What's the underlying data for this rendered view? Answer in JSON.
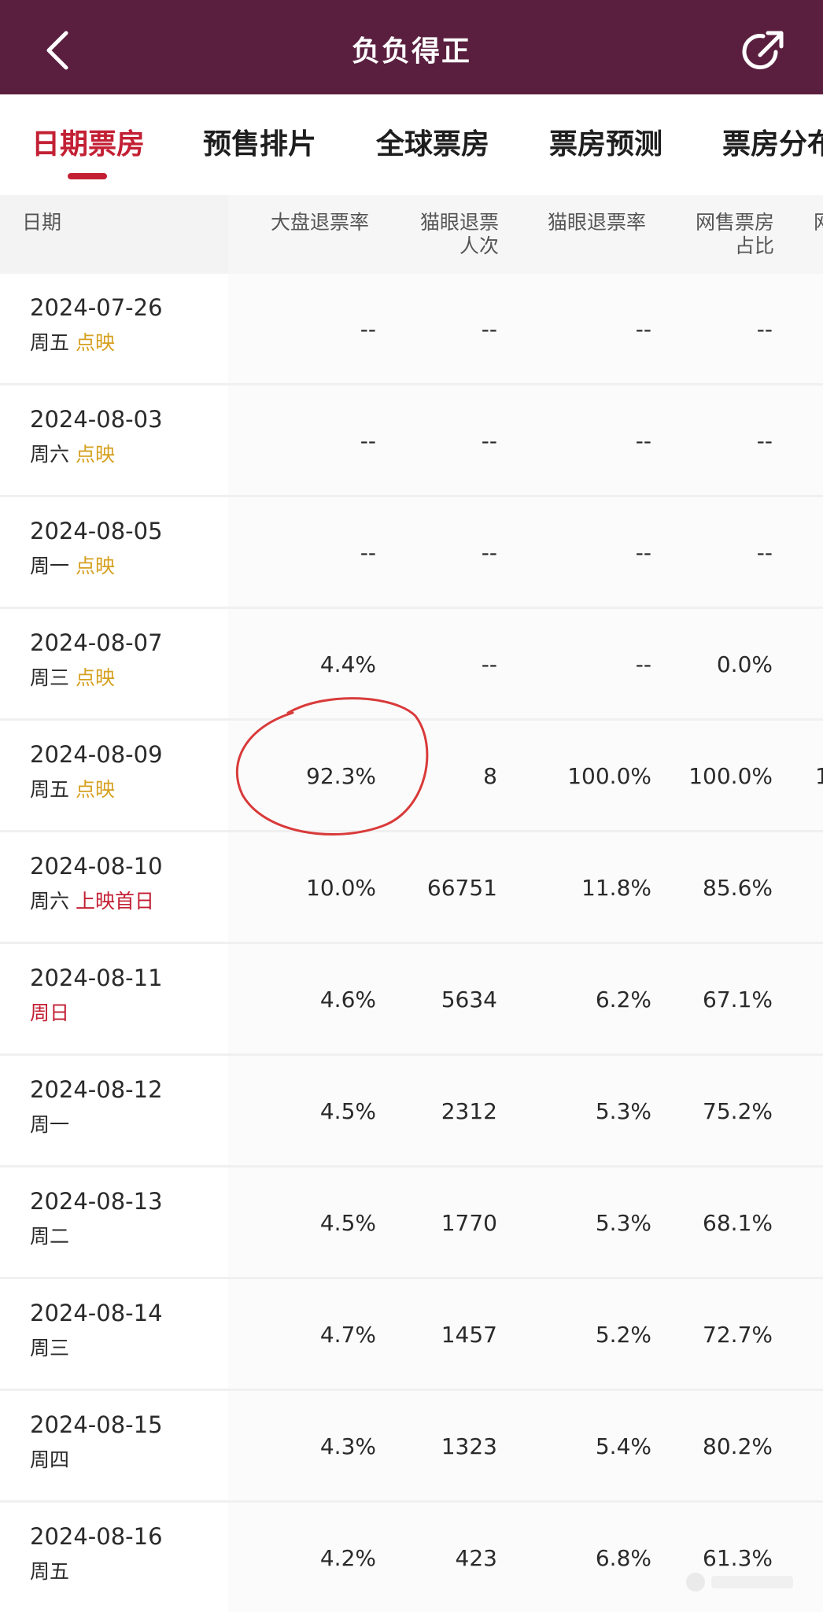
{
  "header": {
    "title": "负负得正",
    "bg_color": "#5a1f3f",
    "back_icon": "chevron-left-icon",
    "share_icon": "share-icon"
  },
  "tabs": [
    {
      "label": "日期票房",
      "active": true
    },
    {
      "label": "预售排片",
      "active": false
    },
    {
      "label": "全球票房",
      "active": false
    },
    {
      "label": "票房预测",
      "active": false
    },
    {
      "label": "票房分布",
      "active": false
    }
  ],
  "accent_color": "#c32034",
  "table": {
    "headers": {
      "date": "日期",
      "col1": "大盘退票率",
      "col2_line1": "猫眼退票",
      "col2_line2": "人次",
      "col3": "猫眼退票率",
      "col4_line1": "网售票房",
      "col4_line2": "占比",
      "col5": "网"
    },
    "rows": [
      {
        "date": "2024-07-26",
        "day": "周五",
        "day_red": false,
        "tag": "点映",
        "tag_color": "gold",
        "c1": "--",
        "c2": "--",
        "c3": "--",
        "c4": "--",
        "c5": ""
      },
      {
        "date": "2024-08-03",
        "day": "周六",
        "day_red": false,
        "tag": "点映",
        "tag_color": "gold",
        "c1": "--",
        "c2": "--",
        "c3": "--",
        "c4": "--",
        "c5": ""
      },
      {
        "date": "2024-08-05",
        "day": "周一",
        "day_red": false,
        "tag": "点映",
        "tag_color": "gold",
        "c1": "--",
        "c2": "--",
        "c3": "--",
        "c4": "--",
        "c5": ""
      },
      {
        "date": "2024-08-07",
        "day": "周三",
        "day_red": false,
        "tag": "点映",
        "tag_color": "gold",
        "c1": "4.4%",
        "c2": "--",
        "c3": "--",
        "c4": "0.0%",
        "c5": ""
      },
      {
        "date": "2024-08-09",
        "day": "周五",
        "day_red": false,
        "tag": "点映",
        "tag_color": "gold",
        "c1": "92.3%",
        "c2": "8",
        "c3": "100.0%",
        "c4": "100.0%",
        "c5": "1"
      },
      {
        "date": "2024-08-10",
        "day": "周六",
        "day_red": false,
        "tag": "上映首日",
        "tag_color": "red",
        "c1": "10.0%",
        "c2": "66751",
        "c3": "11.8%",
        "c4": "85.6%",
        "c5": ""
      },
      {
        "date": "2024-08-11",
        "day": "周日",
        "day_red": true,
        "tag": "",
        "tag_color": "",
        "c1": "4.6%",
        "c2": "5634",
        "c3": "6.2%",
        "c4": "67.1%",
        "c5": ""
      },
      {
        "date": "2024-08-12",
        "day": "周一",
        "day_red": false,
        "tag": "",
        "tag_color": "",
        "c1": "4.5%",
        "c2": "2312",
        "c3": "5.3%",
        "c4": "75.2%",
        "c5": ""
      },
      {
        "date": "2024-08-13",
        "day": "周二",
        "day_red": false,
        "tag": "",
        "tag_color": "",
        "c1": "4.5%",
        "c2": "1770",
        "c3": "5.3%",
        "c4": "68.1%",
        "c5": ""
      },
      {
        "date": "2024-08-14",
        "day": "周三",
        "day_red": false,
        "tag": "",
        "tag_color": "",
        "c1": "4.7%",
        "c2": "1457",
        "c3": "5.2%",
        "c4": "72.7%",
        "c5": ""
      },
      {
        "date": "2024-08-15",
        "day": "周四",
        "day_red": false,
        "tag": "",
        "tag_color": "",
        "c1": "4.3%",
        "c2": "1323",
        "c3": "5.4%",
        "c4": "80.2%",
        "c5": ""
      },
      {
        "date": "2024-08-16",
        "day": "周五",
        "day_red": false,
        "tag": "",
        "tag_color": "",
        "c1": "4.2%",
        "c2": "423",
        "c3": "6.8%",
        "c4": "61.3%",
        "c5": ""
      }
    ]
  }
}
